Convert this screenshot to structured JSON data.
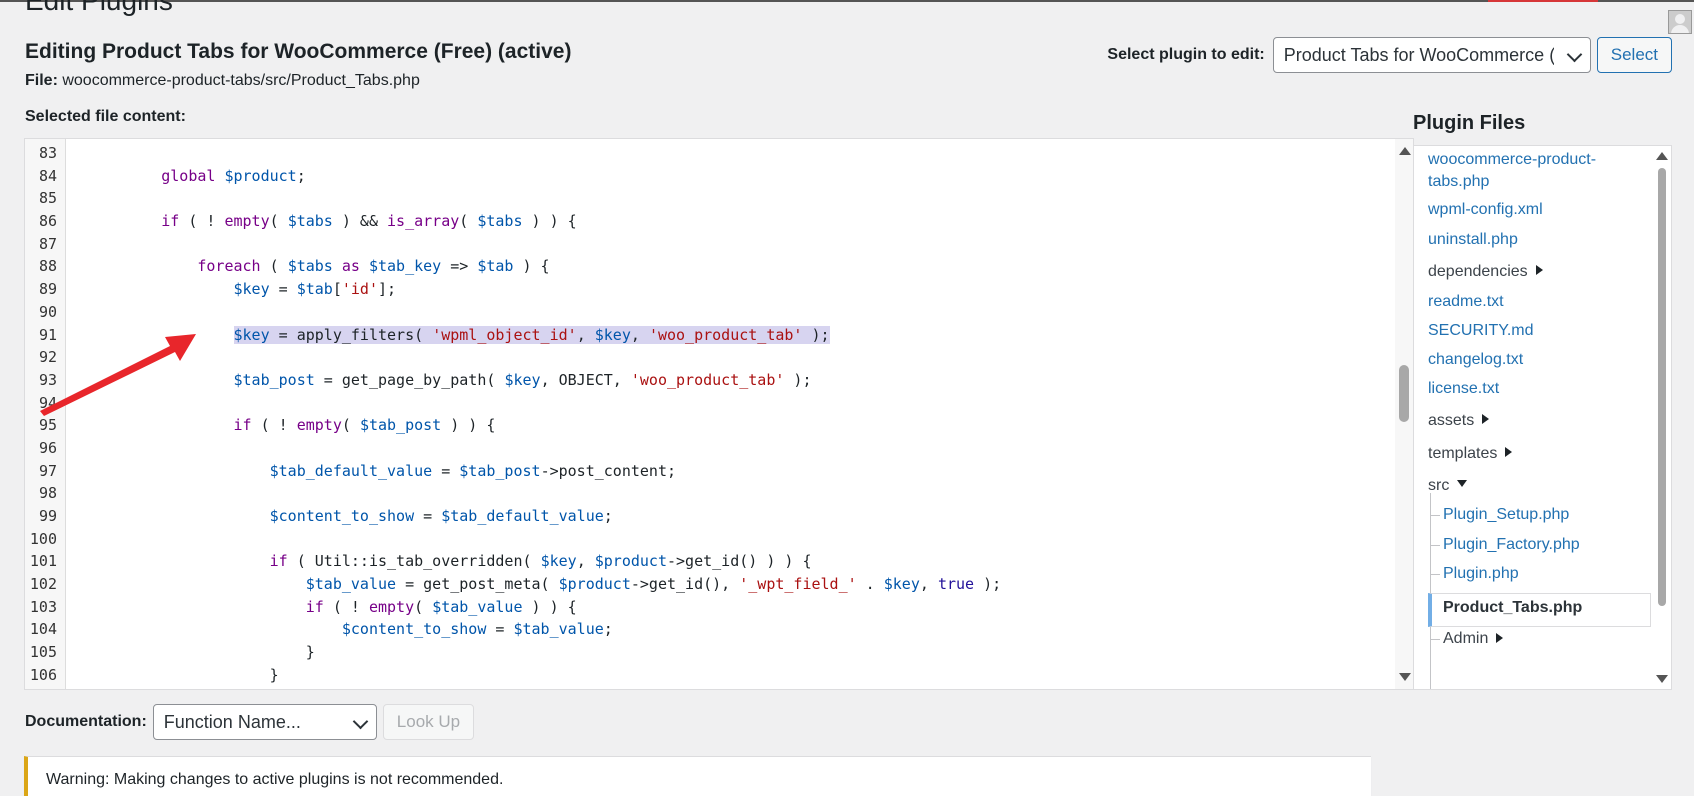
{
  "page": {
    "heading": "Edit Plugins",
    "editing_title": "Editing Product Tabs for WooCommerce (Free) (active)",
    "file_label": "File:",
    "file_path": "woocommerce-product-tabs/src/Product_Tabs.php",
    "selected_file_label": "Selected file content:"
  },
  "plugin_select": {
    "label": "Select plugin to edit:",
    "value": "Product Tabs for WooCommerce (Free)",
    "button": "Select"
  },
  "editor": {
    "lines": [
      {
        "n": "83",
        "tokens": []
      },
      {
        "n": "84",
        "tokens": [
          [
            "        ",
            ""
          ],
          [
            "global",
            "kw"
          ],
          [
            " ",
            ""
          ],
          [
            "$product",
            "var"
          ],
          [
            ";",
            ""
          ]
        ]
      },
      {
        "n": "85",
        "tokens": []
      },
      {
        "n": "86",
        "tokens": [
          [
            "        ",
            ""
          ],
          [
            "if",
            "kw"
          ],
          [
            " ( ! ",
            ""
          ],
          [
            "empty",
            "kw"
          ],
          [
            "( ",
            ""
          ],
          [
            "$tabs",
            "var"
          ],
          [
            " ) && ",
            ""
          ],
          [
            "is_array",
            "kw"
          ],
          [
            "( ",
            ""
          ],
          [
            "$tabs",
            "var"
          ],
          [
            " ) ) {",
            ""
          ]
        ]
      },
      {
        "n": "87",
        "tokens": []
      },
      {
        "n": "88",
        "tokens": [
          [
            "            ",
            ""
          ],
          [
            "foreach",
            "kw"
          ],
          [
            " ( ",
            ""
          ],
          [
            "$tabs",
            "var"
          ],
          [
            " ",
            ""
          ],
          [
            "as",
            "kw"
          ],
          [
            " ",
            ""
          ],
          [
            "$tab_key",
            "var"
          ],
          [
            " => ",
            ""
          ],
          [
            "$tab",
            "var"
          ],
          [
            " ) {",
            ""
          ]
        ]
      },
      {
        "n": "89",
        "tokens": [
          [
            "                ",
            ""
          ],
          [
            "$key",
            "var"
          ],
          [
            " = ",
            ""
          ],
          [
            "$tab",
            "var"
          ],
          [
            "[",
            ""
          ],
          [
            "'id'",
            "str"
          ],
          [
            "];",
            ""
          ]
        ]
      },
      {
        "n": "90",
        "tokens": []
      },
      {
        "n": "91",
        "tokens": [
          [
            "                ",
            ""
          ],
          [
            "$key",
            "var hl"
          ],
          [
            " = apply_filters( ",
            "hl"
          ],
          [
            "'wpml_object_id'",
            "str hl"
          ],
          [
            ", ",
            "hl"
          ],
          [
            "$key",
            "var hl"
          ],
          [
            ", ",
            "hl"
          ],
          [
            "'woo_product_tab'",
            "str hl"
          ],
          [
            " );",
            "hl"
          ]
        ]
      },
      {
        "n": "92",
        "tokens": []
      },
      {
        "n": "93",
        "tokens": [
          [
            "                ",
            ""
          ],
          [
            "$tab_post",
            "var"
          ],
          [
            " = get_page_by_path( ",
            ""
          ],
          [
            "$key",
            "var"
          ],
          [
            ", OBJECT, ",
            ""
          ],
          [
            "'woo_product_tab'",
            "str"
          ],
          [
            " );",
            ""
          ]
        ]
      },
      {
        "n": "94",
        "tokens": []
      },
      {
        "n": "95",
        "tokens": [
          [
            "                ",
            ""
          ],
          [
            "if",
            "kw"
          ],
          [
            " ( ! ",
            ""
          ],
          [
            "empty",
            "kw"
          ],
          [
            "( ",
            ""
          ],
          [
            "$tab_post",
            "var"
          ],
          [
            " ) ) {",
            ""
          ]
        ]
      },
      {
        "n": "96",
        "tokens": []
      },
      {
        "n": "97",
        "tokens": [
          [
            "                    ",
            ""
          ],
          [
            "$tab_default_value",
            "var"
          ],
          [
            " = ",
            ""
          ],
          [
            "$tab_post",
            "var"
          ],
          [
            "->post_content;",
            ""
          ]
        ]
      },
      {
        "n": "98",
        "tokens": []
      },
      {
        "n": "99",
        "tokens": [
          [
            "                    ",
            ""
          ],
          [
            "$content_to_show",
            "var"
          ],
          [
            " = ",
            ""
          ],
          [
            "$tab_default_value",
            "var"
          ],
          [
            ";",
            ""
          ]
        ]
      },
      {
        "n": "100",
        "tokens": []
      },
      {
        "n": "101",
        "tokens": [
          [
            "                    ",
            ""
          ],
          [
            "if",
            "kw"
          ],
          [
            " ( Util::is_tab_overridden( ",
            ""
          ],
          [
            "$key",
            "var"
          ],
          [
            ", ",
            ""
          ],
          [
            "$product",
            "var"
          ],
          [
            "->get_id() ) ) {",
            ""
          ]
        ]
      },
      {
        "n": "102",
        "tokens": [
          [
            "                        ",
            ""
          ],
          [
            "$tab_value",
            "var"
          ],
          [
            " = get_post_meta( ",
            ""
          ],
          [
            "$product",
            "var"
          ],
          [
            "->get_id(), ",
            ""
          ],
          [
            "'_wpt_field_'",
            "str"
          ],
          [
            " . ",
            ""
          ],
          [
            "$key",
            "var"
          ],
          [
            ", ",
            ""
          ],
          [
            "true",
            "atom"
          ],
          [
            " );",
            ""
          ]
        ]
      },
      {
        "n": "103",
        "tokens": [
          [
            "                        ",
            ""
          ],
          [
            "if",
            "kw"
          ],
          [
            " ( ! ",
            ""
          ],
          [
            "empty",
            "kw"
          ],
          [
            "( ",
            ""
          ],
          [
            "$tab_value",
            "var"
          ],
          [
            " ) ) {",
            ""
          ]
        ]
      },
      {
        "n": "104",
        "tokens": [
          [
            "                            ",
            ""
          ],
          [
            "$content_to_show",
            "var"
          ],
          [
            " = ",
            ""
          ],
          [
            "$tab_value",
            "var"
          ],
          [
            ";",
            ""
          ]
        ]
      },
      {
        "n": "105",
        "tokens": [
          [
            "                        }",
            ""
          ]
        ]
      },
      {
        "n": "106",
        "tokens": [
          [
            "                    }",
            ""
          ]
        ]
      }
    ]
  },
  "plugin_files": {
    "heading": "Plugin Files",
    "items": [
      {
        "label": "woocommerce-product-",
        "label2": "tabs.php",
        "type": "file"
      },
      {
        "label": "wpml-config.xml",
        "type": "file"
      },
      {
        "label": "uninstall.php",
        "type": "file"
      },
      {
        "label": "dependencies",
        "type": "dir"
      },
      {
        "label": "readme.txt",
        "type": "file"
      },
      {
        "label": "SECURITY.md",
        "type": "file"
      },
      {
        "label": "changelog.txt",
        "type": "file"
      },
      {
        "label": "license.txt",
        "type": "file"
      },
      {
        "label": "assets",
        "type": "dir"
      },
      {
        "label": "templates",
        "type": "dir"
      },
      {
        "label": "src",
        "type": "dir-open"
      }
    ],
    "src_children": [
      {
        "label": "Plugin_Setup.php"
      },
      {
        "label": "Plugin_Factory.php"
      },
      {
        "label": "Plugin.php"
      },
      {
        "label": "Product_Tabs.php",
        "active": true
      },
      {
        "label": "Admin",
        "type": "dir"
      }
    ]
  },
  "documentation": {
    "label": "Documentation:",
    "select_value": "Function Name...",
    "button": "Look Up"
  },
  "warning": {
    "text": "Warning: Making changes to active plugins is not recommended."
  },
  "colors": {
    "annotation_arrow": "#e8262b",
    "selection_highlight": "#d7d4f0",
    "link": "#2271b1",
    "warning_border": "#dba617"
  }
}
